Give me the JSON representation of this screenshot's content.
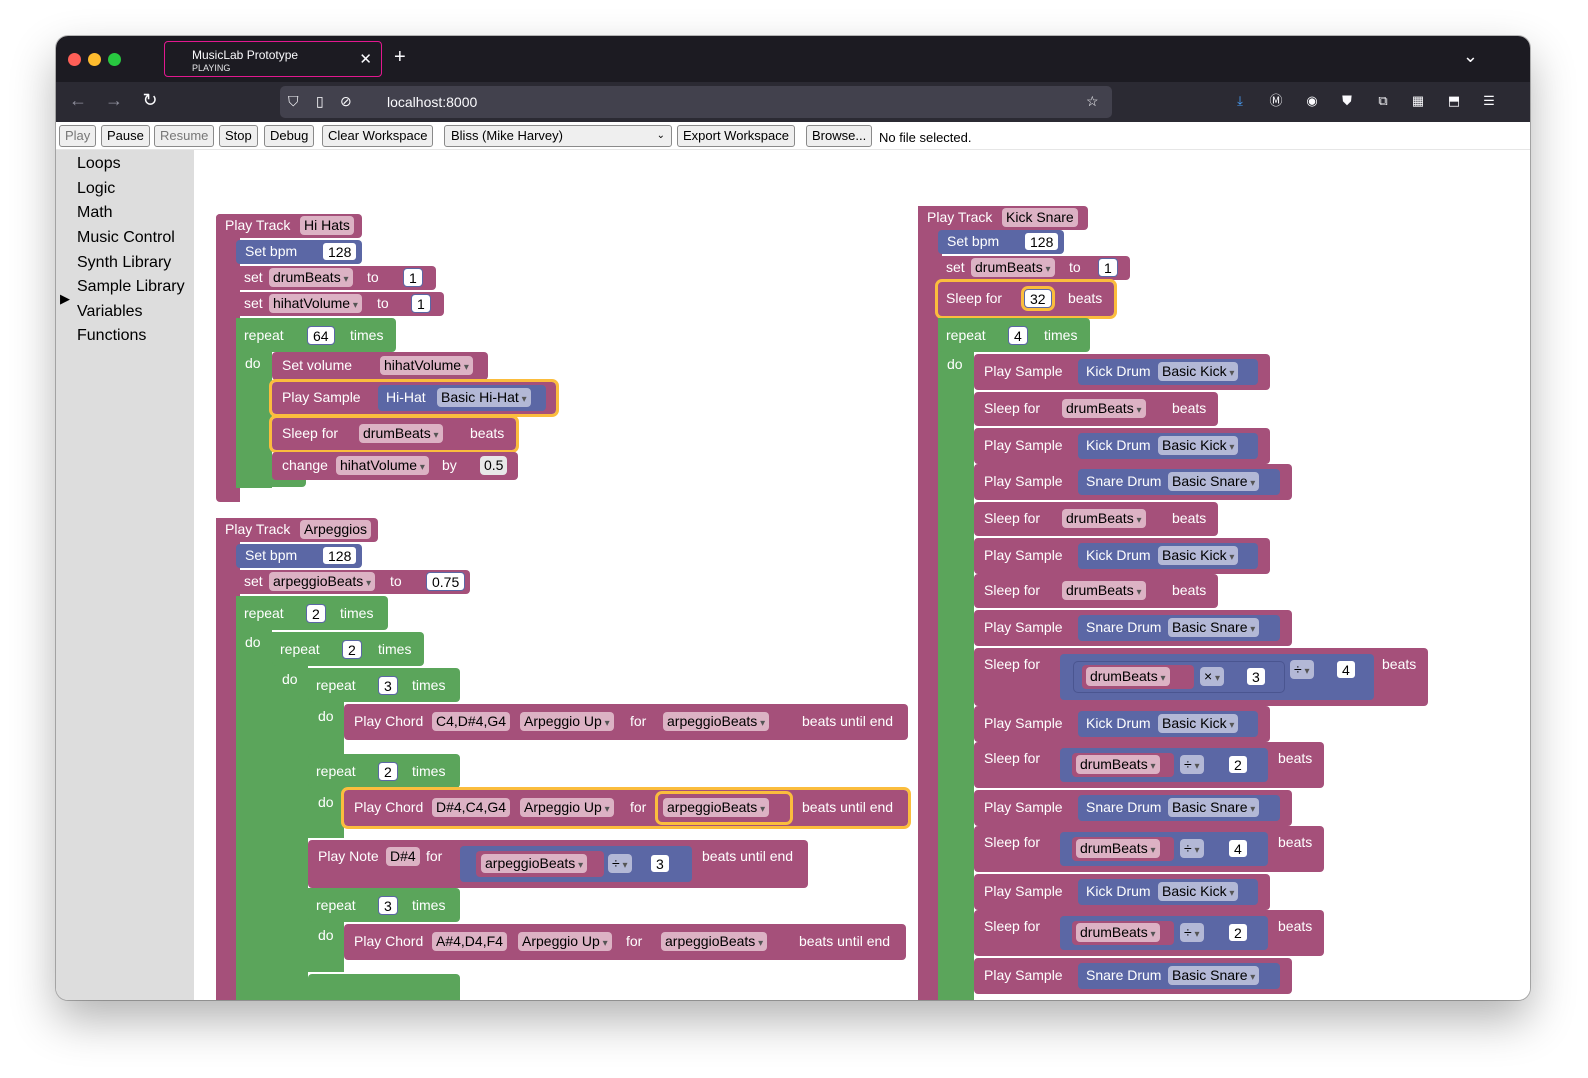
{
  "browser": {
    "tab_title": "MusicLab Prototype",
    "tab_subtitle": "PLAYING",
    "url": "localhost:8000"
  },
  "toolbar": {
    "play": "Play",
    "pause": "Pause",
    "resume": "Resume",
    "stop": "Stop",
    "debug": "Debug",
    "clear": "Clear Workspace",
    "song_select": "Bliss (Mike Harvey)",
    "export": "Export Workspace",
    "browse": "Browse...",
    "file_status": "No file selected."
  },
  "sidebar": {
    "categories": [
      "Loops",
      "Logic",
      "Math",
      "Music Control",
      "Synth Library",
      "Sample Library",
      "Variables",
      "Functions"
    ],
    "expanded_marker": "▶"
  },
  "blocks": {
    "play_track": "Play Track",
    "set_bpm": "Set bpm",
    "set": "set",
    "to": "to",
    "repeat": "repeat",
    "times": "times",
    "do": "do",
    "set_volume": "Set volume",
    "play_sample": "Play Sample",
    "sleep_for": "Sleep for",
    "beats": "beats",
    "change": "change",
    "by": "by",
    "play_chord": "Play Chord",
    "for": "for",
    "beats_until_end": "beats until end",
    "play_note": "Play Note"
  },
  "track_hihats": {
    "name": "Hi Hats",
    "bpm": "128",
    "var1": "drumBeats",
    "var1_val": "1",
    "var2": "hihatVolume",
    "var2_val": "1",
    "repeat": "64",
    "volume_var": "hihatVolume",
    "sample_kind": "Hi-Hat",
    "sample_name": "Basic Hi-Hat",
    "sleep_var": "drumBeats",
    "change_var": "hihatVolume",
    "change_by": "0.5"
  },
  "track_arp": {
    "name": "Arpeggios",
    "bpm": "128",
    "var": "arpeggioBeats",
    "var_val": "0.75",
    "repeat1": "2",
    "repeat2": "2",
    "repeat3": "3",
    "chord1": "C4,D#4,G4",
    "mode": "Arpeggio Up",
    "beats_var": "arpeggioBeats",
    "repeat4": "2",
    "chord2": "D#4,C4,G4",
    "note": "D#4",
    "div_op": "÷",
    "div_val": "3",
    "repeat5": "3",
    "chord3": "A#4,D4,F4"
  },
  "track_kick": {
    "name": "Kick Snare",
    "bpm": "128",
    "var": "drumBeats",
    "var_val": "1",
    "sleep_beats": "32",
    "repeat": "4",
    "kick_kind": "Kick Drum",
    "kick_name": "Basic Kick",
    "snare_kind": "Snare Drum",
    "snare_name": "Basic Snare",
    "sleep_var": "drumBeats",
    "mul_op": "×",
    "mul_val": "3",
    "div_op": "÷",
    "div_val4": "4",
    "div_val2": "2"
  }
}
